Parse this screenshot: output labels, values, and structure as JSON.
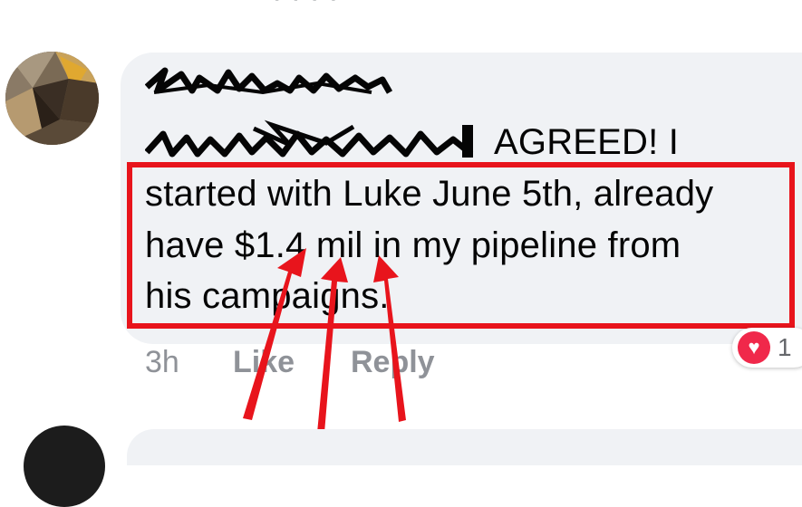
{
  "comment": {
    "text_line_1": "AGREED! I",
    "text_line_2": "started with Luke June 5th, already",
    "text_line_3": "have $1.4 mil in my pipeline from",
    "text_line_4": "his campaigns.",
    "time": "3h",
    "like_label": "Like",
    "reply_label": "Reply",
    "reaction_icon": "heart-icon",
    "reaction_count": "1"
  },
  "colors": {
    "highlight": "#e8141c",
    "bubble": "#f0f2f5",
    "meta_text": "#8f9298",
    "heart": "#f0284a"
  }
}
